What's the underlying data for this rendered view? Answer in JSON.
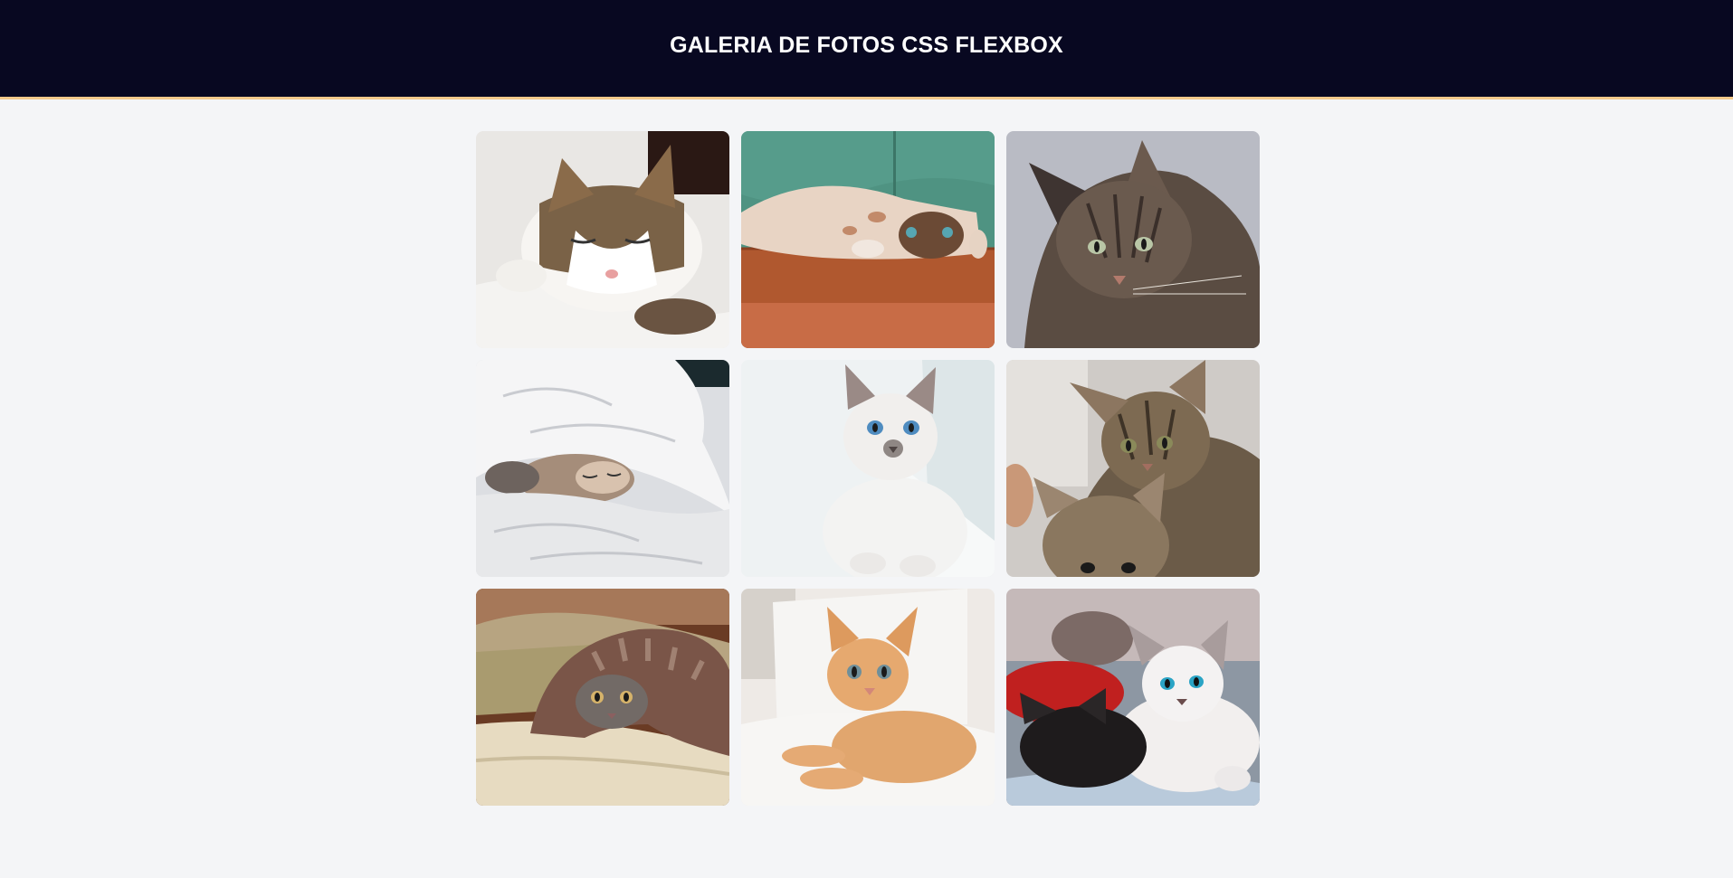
{
  "header": {
    "title": "GALERIA DE FOTOS CSS FLEXBOX"
  },
  "colors": {
    "header_bg": "#080821",
    "header_border": "#f3c98b",
    "page_bg": "#f4f5f7"
  },
  "gallery": {
    "photos": [
      {
        "name": "sleeping-tabby-white-cat"
      },
      {
        "name": "kitten-lying-on-wood-floor"
      },
      {
        "name": "gray-tabby-cat-portrait"
      },
      {
        "name": "kitten-under-white-blanket"
      },
      {
        "name": "white-siamese-kitten"
      },
      {
        "name": "two-tabby-kittens"
      },
      {
        "name": "gray-kitten-under-brown-blanket"
      },
      {
        "name": "orange-kitten-lying"
      },
      {
        "name": "black-and-white-kittens"
      }
    ]
  }
}
